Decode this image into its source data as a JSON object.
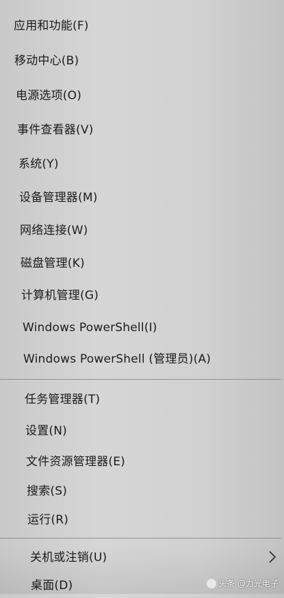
{
  "menu": {
    "items": [
      {
        "label": "应用和功能(F)"
      },
      {
        "label": "移动中心(B)"
      },
      {
        "label": "电源选项(O)"
      },
      {
        "label": "事件查看器(V)"
      },
      {
        "label": "系统(Y)"
      },
      {
        "label": "设备管理器(M)"
      },
      {
        "label": "网络连接(W)"
      },
      {
        "label": "磁盘管理(K)"
      },
      {
        "label": "计算机管理(G)"
      },
      {
        "label": "Windows PowerShell(I)"
      },
      {
        "label": "Windows PowerShell (管理员)(A)"
      },
      {
        "label": "任务管理器(T)"
      },
      {
        "label": "设置(N)"
      },
      {
        "label": "文件资源管理器(E)"
      },
      {
        "label": "搜索(S)"
      },
      {
        "label": "运行(R)"
      },
      {
        "label": "关机或注销(U)",
        "icon": "chevron-right-icon"
      },
      {
        "label": "桌面(D)"
      }
    ]
  },
  "watermark": {
    "text": "头条 @力光电子"
  }
}
